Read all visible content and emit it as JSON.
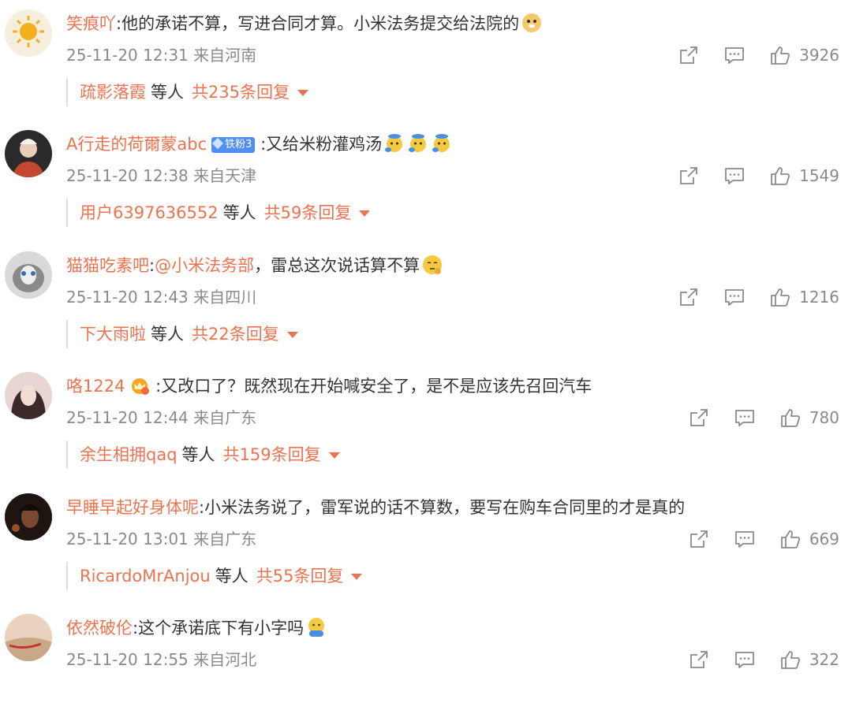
{
  "comments": [
    {
      "username": "笑痕吖",
      "text": ":他的承诺不算，写进合同才算。小米法务提交给法院的",
      "time": "25-11-20 12:31",
      "location": "来自河南",
      "likes": "3926",
      "reply_user": "疏影落霞",
      "reply_etc": "等人",
      "reply_total": "共235条回复"
    },
    {
      "username": "A行走的荷爾蒙abc",
      "badge": "铁粉3",
      "text": ":又给米粉灌鸡汤",
      "time": "25-11-20 12:38",
      "location": "来自天津",
      "likes": "1549",
      "reply_user": "用户6397636552",
      "reply_etc": "等人",
      "reply_total": "共59条回复"
    },
    {
      "username": "猫猫吃素吧",
      "text_pre": ":",
      "mention": "@小米法务部",
      "text": "，雷总这次说话算不算",
      "time": "25-11-20 12:43",
      "location": "来自四川",
      "likes": "1216",
      "reply_user": "下大雨啦",
      "reply_etc": "等人",
      "reply_total": "共22条回复"
    },
    {
      "username": "咯1224",
      "text": ":又改口了？既然现在开始喊安全了，是不是应该先召回汽车",
      "time": "25-11-20 12:44",
      "location": "来自广东",
      "likes": "780",
      "reply_user": "余生相拥qaq",
      "reply_etc": "等人",
      "reply_total": "共159条回复"
    },
    {
      "username": "早睡早起好身体呢",
      "text": ":小米法务说了，雷军说的话不算数，要写在购车合同里的才是真的",
      "time": "25-11-20 13:01",
      "location": "来自广东",
      "likes": "669",
      "reply_user": "RicardoMrAnjou",
      "reply_etc": "等人",
      "reply_total": "共55条回复"
    },
    {
      "username": "依然破伦",
      "text": ":这个承诺底下有小字吗",
      "time": "25-11-20 12:55",
      "location": "来自河北",
      "likes": "322"
    }
  ],
  "icons": {
    "share": "share-icon",
    "comment": "comment-icon",
    "like": "thumbs-up-icon",
    "expand": "caret-down-icon"
  },
  "colors": {
    "accent": "#eb7350",
    "meta": "#8a8a8a",
    "badge": "#4f8ff0"
  }
}
